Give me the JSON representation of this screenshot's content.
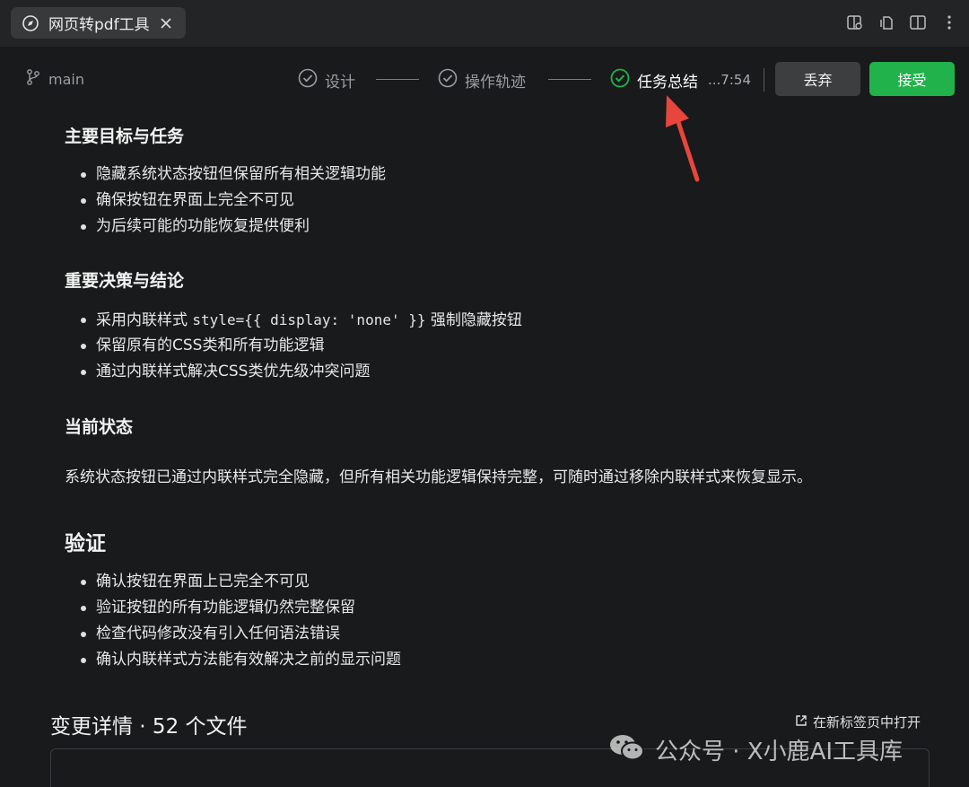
{
  "tab": {
    "title": "网页转pdf工具"
  },
  "toolbar": {
    "branch": "main",
    "steps": [
      {
        "label": "设计",
        "state": "done"
      },
      {
        "label": "操作轨迹",
        "state": "done"
      },
      {
        "label": "任务总结",
        "state": "active"
      }
    ],
    "timestamp": "...7:54",
    "discard_label": "丢弃",
    "accept_label": "接受"
  },
  "summary": {
    "goals": {
      "heading": "主要目标与任务",
      "items": [
        "隐藏系统状态按钮但保留所有相关逻辑功能",
        "确保按钮在界面上完全不可见",
        "为后续可能的功能恢复提供便利"
      ]
    },
    "decisions": {
      "heading": "重要决策与结论",
      "item0_prefix": "采用内联样式",
      "item0_code": "style={{ display: 'none' }}",
      "item0_suffix": "强制隐藏按钮",
      "item1": "保留原有的CSS类和所有功能逻辑",
      "item2": "通过内联样式解决CSS类优先级冲突问题"
    },
    "status": {
      "heading": "当前状态",
      "text": "系统状态按钮已通过内联样式完全隐藏，但所有相关功能逻辑保持完整，可随时通过移除内联样式来恢复显示。"
    },
    "verify": {
      "heading": "验证",
      "items": [
        "确认按钮在界面上已完全不可见",
        "验证按钮的所有功能逻辑仍然完整保留",
        "检查代码修改没有引入任何语法错误",
        "确认内联样式方法能有效解决之前的显示问题"
      ]
    }
  },
  "changes": {
    "title": "变更详情 · 52 个文件",
    "open_in_tab": "在新标签页中打开"
  },
  "watermark": {
    "text": "公众号 · X小鹿AI工具库"
  },
  "colors": {
    "accent_green": "#22b24c",
    "annotation_red": "#e8453c"
  }
}
